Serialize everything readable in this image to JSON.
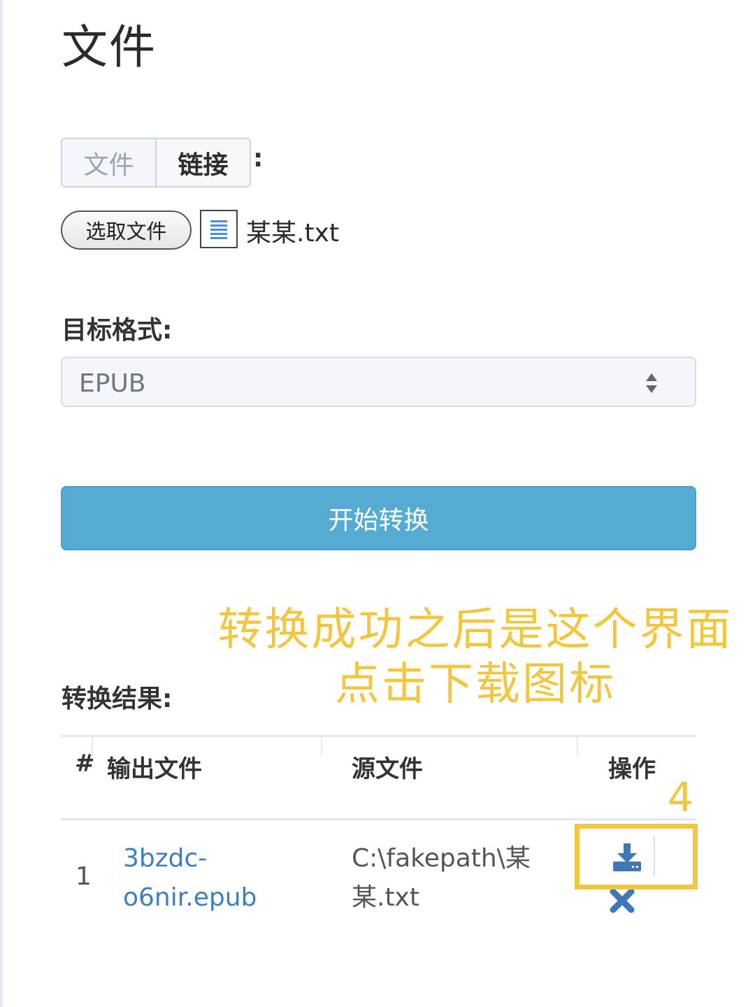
{
  "page": {
    "title": "文件"
  },
  "source_tabs": {
    "file_label": "文件",
    "link_label": "链接",
    "colon": ":"
  },
  "file_input": {
    "button_label": "选取文件",
    "file_name": "某某.txt",
    "file_icon": "document-icon"
  },
  "target_format": {
    "label": "目标格式:",
    "selected": "EPUB",
    "caret_icon": "select-caret-icon"
  },
  "convert_button": {
    "label": "开始转换"
  },
  "annotation": {
    "line1": "转换成功之后是这个界面",
    "line2": "点击下载图标",
    "step": "4",
    "color": "#f3c640"
  },
  "results": {
    "label": "转换结果:",
    "headers": {
      "index": "#",
      "output": "输出文件",
      "source": "源文件",
      "action": "操作"
    },
    "rows": [
      {
        "index": "1",
        "output_line1": "3bzdc-",
        "output_line2": "o6nir.epub",
        "source_line1": "C:\\fakepath\\某",
        "source_line2": "某.txt",
        "download_icon": "download-icon",
        "delete_icon": "close-icon"
      }
    ]
  },
  "colors": {
    "primary_button": "#56abd3",
    "link": "#3d7fbf",
    "action_icon": "#3f78b7"
  }
}
